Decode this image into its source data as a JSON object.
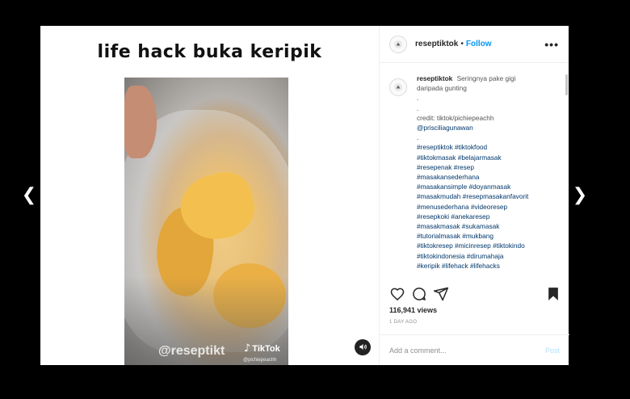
{
  "nav": {
    "prev_icon": "chevron-left-icon",
    "next_icon": "chevron-right-icon",
    "prev_glyph": "❮",
    "next_glyph": "❯"
  },
  "media": {
    "title": "life hack buka keripik",
    "watermark": "@reseptikt",
    "tiktok_brand": "TikTok",
    "watermark_sub": "@pichiepeachh",
    "sound_icon": "speaker-icon"
  },
  "header": {
    "username": "reseptiktok",
    "separator": "•",
    "follow_label": "Follow",
    "more_label": "•••"
  },
  "caption": {
    "username": "reseptiktok",
    "text_lines": [
      "Seringnya pake gigi",
      "daripada gunting"
    ],
    "dot1": ".",
    "dot2": ".",
    "credit_label": "credit: tiktok/pichiepeachh",
    "mention": "@prisciliagunawan",
    "dot3": ".",
    "hashtag_lines": [
      "#reseptiktok #tiktokfood",
      "#tiktokmasak #belajarmasak",
      "#resepenak #resep",
      "#masakansederhana",
      "#masakansimple #doyanmasak",
      "#masakmudah #resepmasakanfavorit",
      "#menusederhana #videoresep",
      "#resepkoki #anekaresep",
      "#masakmasak #sukamasak",
      "#tutorialmasak #mukbang",
      "#tiktokresep #micinresep #tiktokindo",
      "#tiktokindonesia #dirumahaja",
      "#keripik #lifehack #lifehacks"
    ]
  },
  "actions": {
    "like_icon": "heart-icon",
    "comment_icon": "comment-icon",
    "share_icon": "share-icon",
    "save_icon": "bookmark-icon"
  },
  "views": "116,941 views",
  "date": "1 DAY AGO",
  "comment_box": {
    "placeholder": "Add a comment...",
    "post_label": "Post"
  }
}
